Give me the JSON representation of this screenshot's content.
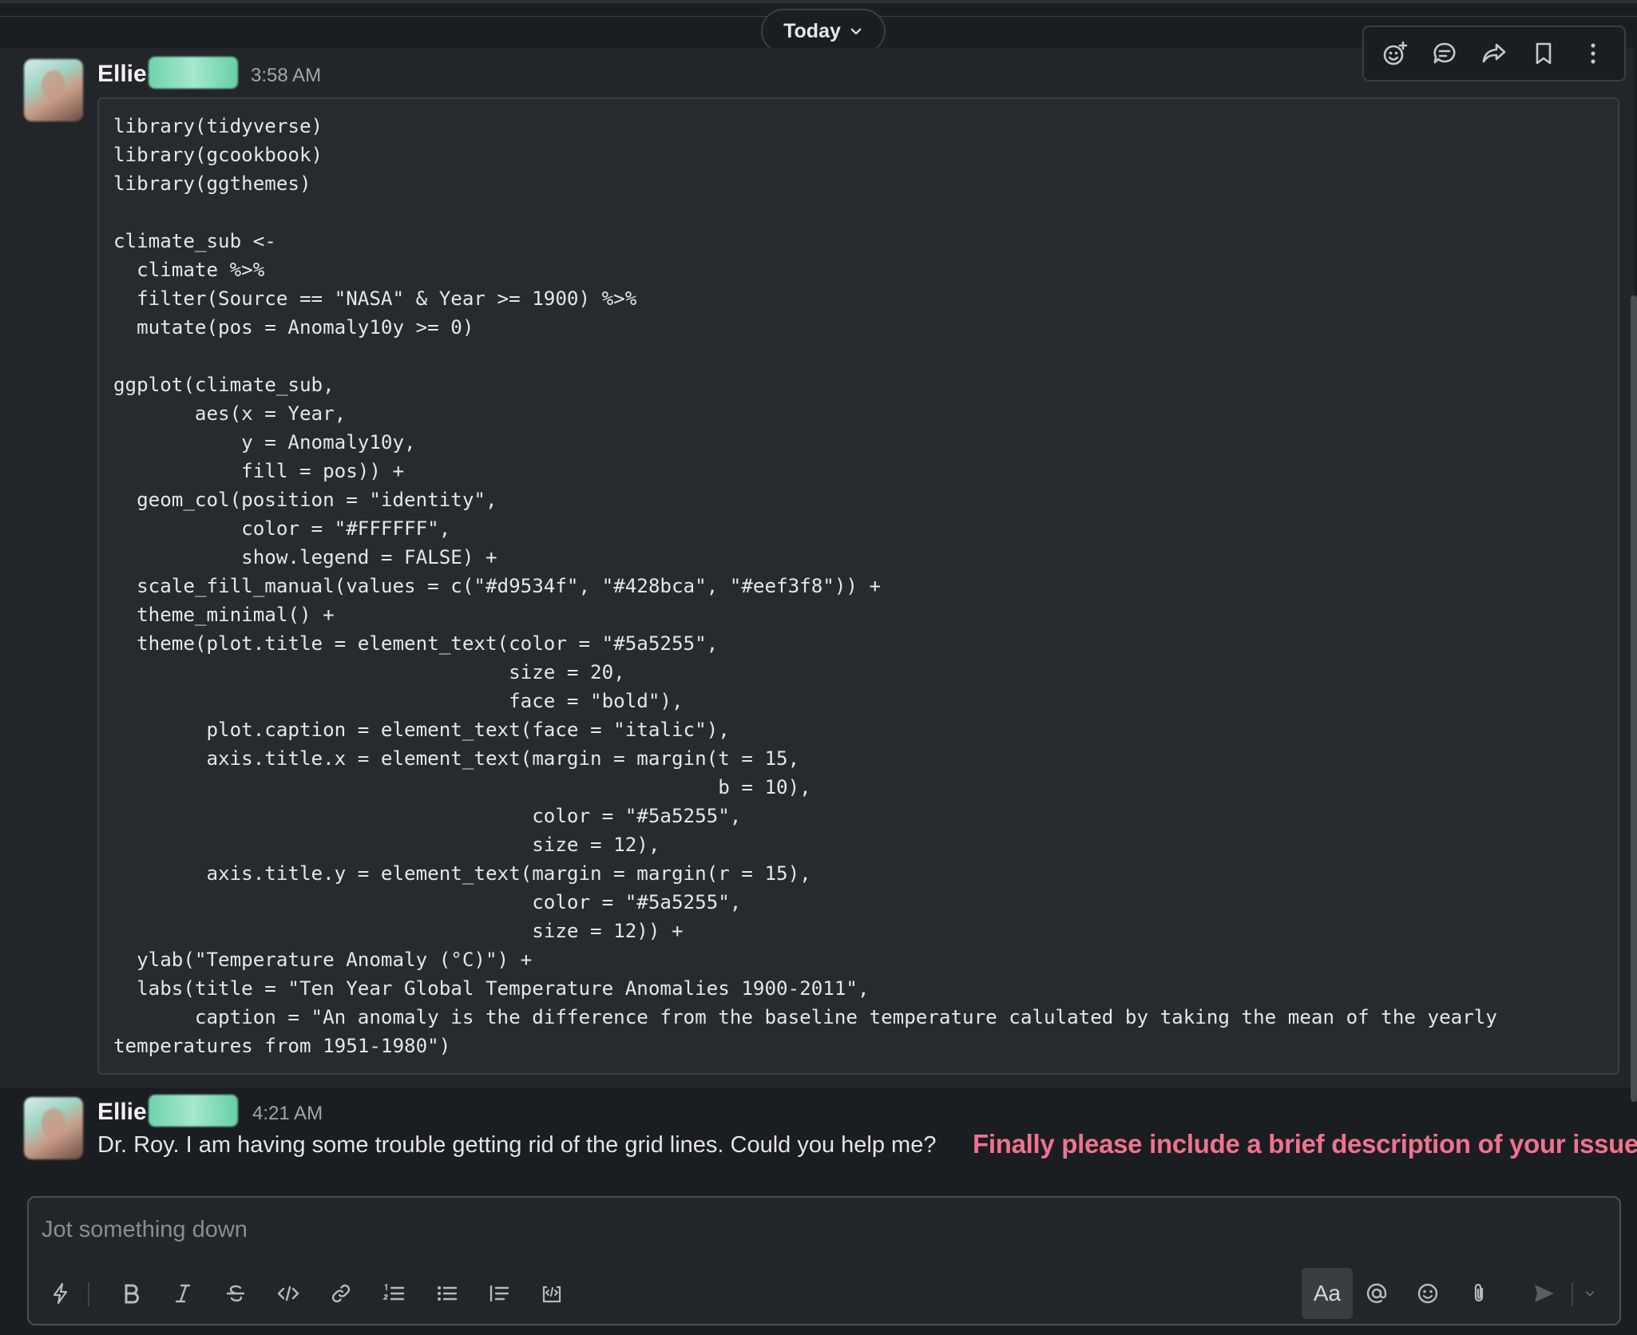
{
  "header": {
    "date_filter_label": "Today"
  },
  "messages": [
    {
      "username": "Ellie",
      "time": "3:58 AM",
      "code_lines": [
        "library(tidyverse)",
        "library(gcookbook)",
        "library(ggthemes)",
        "",
        "climate_sub <-",
        "  climate %>%",
        "  filter(Source == \"NASA\" & Year >= 1900) %>%",
        "  mutate(pos = Anomaly10y >= 0)",
        "",
        "ggplot(climate_sub,",
        "       aes(x = Year,",
        "           y = Anomaly10y,",
        "           fill = pos)) +",
        "  geom_col(position = \"identity\",",
        "           color = \"#FFFFFF\",",
        "           show.legend = FALSE) +",
        "  scale_fill_manual(values = c(\"#d9534f\", \"#428bca\", \"#eef3f8\")) +",
        "  theme_minimal() +",
        "  theme(plot.title = element_text(color = \"#5a5255\",",
        "                                  size = 20,",
        "                                  face = \"bold\"),",
        "        plot.caption = element_text(face = \"italic\"),",
        "        axis.title.x = element_text(margin = margin(t = 15,",
        "                                                    b = 10),",
        "                                    color = \"#5a5255\",",
        "                                    size = 12),",
        "        axis.title.y = element_text(margin = margin(r = 15),",
        "                                    color = \"#5a5255\",",
        "                                    size = 12)) +",
        "  ylab(\"Temperature Anomaly (°C)\") +",
        "  labs(title = \"Ten Year Global Temperature Anomalies 1900-2011\",",
        "       caption = \"An anomaly is the difference from the baseline temperature calulated by taking the mean of the yearly",
        "temperatures from 1951-1980\")"
      ]
    },
    {
      "username": "Ellie",
      "time": "4:21 AM",
      "text": "Dr. Roy. I am having some trouble getting rid of the grid lines. Could you help me?"
    }
  ],
  "annotation": "Finally please include a brief description of your issue",
  "hover_toolbar": [
    "add-reaction-icon",
    "reply-in-thread-icon",
    "share-icon",
    "bookmark-icon",
    "more-actions-icon"
  ],
  "composer": {
    "placeholder": "Jot something down",
    "value": "",
    "format_button_label": "Aa",
    "tools": [
      "shortcuts-icon",
      "bold-icon",
      "italic-icon",
      "strikethrough-icon",
      "code-icon",
      "link-icon",
      "ordered-list-icon",
      "bulleted-list-icon",
      "blockquote-icon",
      "code-block-icon",
      "mention-icon",
      "emoji-icon",
      "attachment-icon",
      "send-icon",
      "send-options-chevron-icon"
    ]
  },
  "colors": {
    "background": "#1a1d21",
    "message_hover": "#222529",
    "annotation": "#f0728f",
    "badge": "#7ad7b3"
  }
}
